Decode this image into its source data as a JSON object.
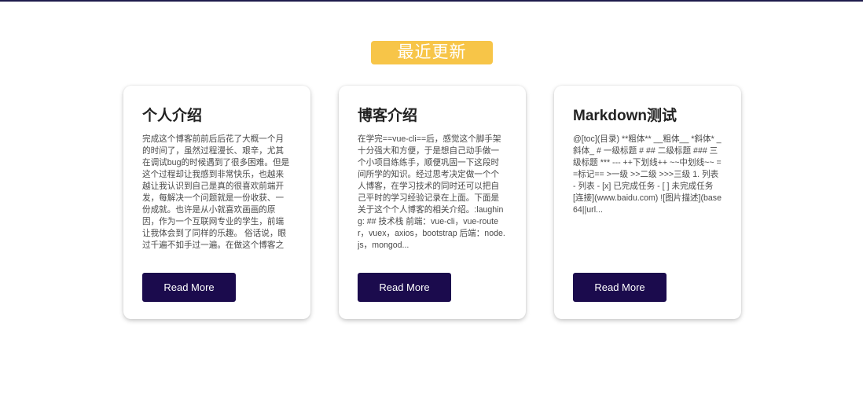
{
  "section": {
    "badge_label": "最近更新"
  },
  "colors": {
    "badge": "#f7c548",
    "button": "#1b0b4d",
    "top_rule": "#1e1b4b"
  },
  "posts": [
    {
      "title": "个人介绍",
      "excerpt": "完成这个博客前前后后花了大概一个月的时间了，虽然过程漫长、艰辛，尤其在调试bug的时候遇到了很多困难。但是这个过程却让我感到非常快乐，也越来越让我认识到自己是真的很喜欢前端开发，每解决一个问题就是一份收获、一份成就。也许是从小就喜欢画画的原因，作为一个互联网专业的学生，前端让我体会到了同样的乐趣。 俗话说，眼过千遍不如手过一遍。在做这个博客之前，系统地学了一遍当今前端比较前沿的知识，包括vue、r...",
      "button_label": "Read More"
    },
    {
      "title": "博客介绍",
      "excerpt": "在学完==vue-cli==后，感觉这个脚手架十分强大和方便，于是想自己动手做一个小项目练练手，顺便巩固一下这段时间所学的知识。经过思考决定做一个个人博客，在学习技术的同时还可以把自己平时的学习经验记录在上面。下面是关于这个个人博客的相关介绍。:laughing: ## 技术栈 前端：vue-cli，vue-router，vuex，axios，bootstrap 后端：node.js，mongod...",
      "button_label": "Read More"
    },
    {
      "title": "Markdown测试",
      "excerpt": "@[toc](目录) **粗体** __粗体__ *斜体* _斜体_ # 一级标题 # ## 二级标题 ### 三级标题 *** --- ++下划线++ ~~中划线~~ ==标记== >一级 >>二级 >>>三级 1. 列表 - 列表 - [x] 已完成任务 - [ ] 未完成任务 [连接](www.baidu.com) ![图片描述](base64||url...",
      "button_label": "Read More"
    }
  ]
}
